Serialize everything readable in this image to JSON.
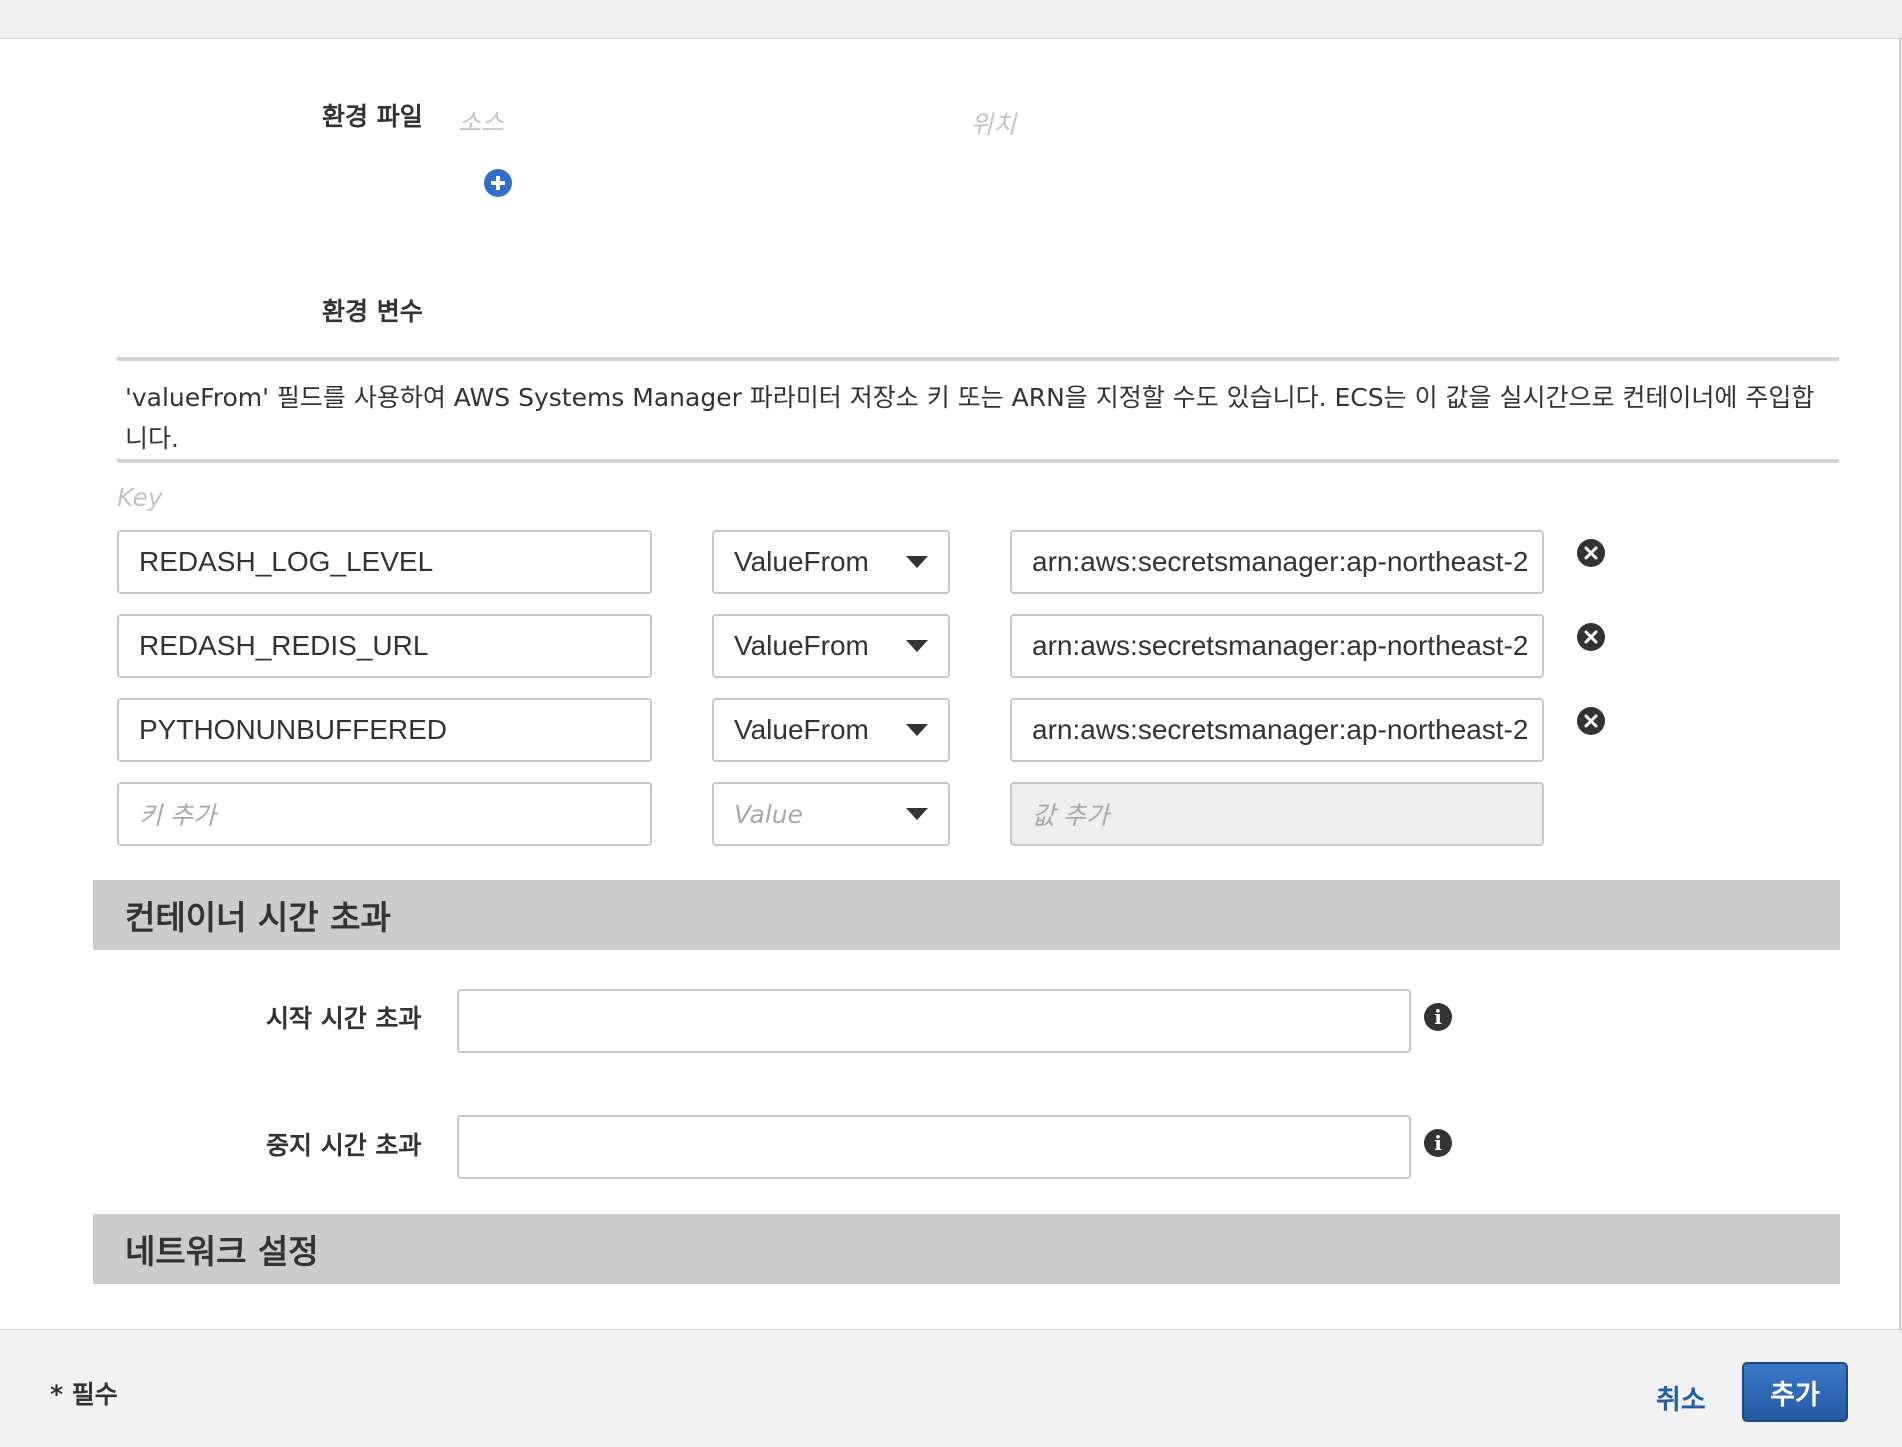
{
  "env_files": {
    "label": "환경 파일",
    "col_source": "소스",
    "col_location": "위치"
  },
  "env_vars": {
    "label": "환경 변수",
    "note": "'valueFrom' 필드를 사용하여 AWS Systems Manager 파라미터 저장소 키 또는 ARN을 지정할 수도 있습니다. ECS는 이 값을 실시간으로 컨테이너에 주입합니다.",
    "key_header": "Key",
    "rows": [
      {
        "key": "REDASH_LOG_LEVEL",
        "type": "ValueFrom",
        "value": "arn:aws:secretsmanager:ap-northeast-2"
      },
      {
        "key": "REDASH_REDIS_URL",
        "type": "ValueFrom",
        "value": "arn:aws:secretsmanager:ap-northeast-2"
      },
      {
        "key": "PYTHONUNBUFFERED",
        "type": "ValueFrom",
        "value": "arn:aws:secretsmanager:ap-northeast-2"
      }
    ],
    "new_row": {
      "key_placeholder": "키 추가",
      "type_placeholder": "Value",
      "value_placeholder": "값 추가"
    }
  },
  "container_timeouts": {
    "title": "컨테이너 시간 초과",
    "start_label": "시작 시간 초과",
    "start_value": "",
    "stop_label": "중지 시간 초과",
    "stop_value": ""
  },
  "network": {
    "title": "네트워크 설정"
  },
  "footer": {
    "required": "* 필수",
    "cancel": "취소",
    "add": "추가"
  },
  "icons": {
    "add_env_file": "plus-circle-icon",
    "remove_row": "close-circle-icon",
    "info": "info-icon"
  },
  "colors": {
    "primary_button": "#2f6bbd",
    "link": "#1f5fa8",
    "section_header_bg": "#cccccc"
  }
}
